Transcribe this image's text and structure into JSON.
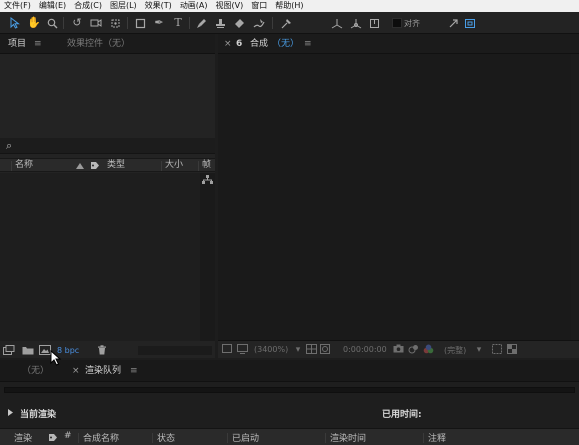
{
  "menu": [
    "文件(F)",
    "编辑(E)",
    "合成(C)",
    "图层(L)",
    "效果(T)",
    "动画(A)",
    "视图(V)",
    "窗口",
    "帮助(H)"
  ],
  "toolbar": {
    "snap_label": "对齐"
  },
  "project_panel": {
    "tab_project": "项目",
    "tab_menu": "≡",
    "tab_effects": "效果控件（无）",
    "search_icon": "⌕",
    "columns": {
      "name": "名称",
      "type": "类型",
      "size": "大小",
      "frame": "帧"
    },
    "bpc": "8 bpc"
  },
  "comp_panel": {
    "close": "×",
    "lock": "6",
    "title": "合成",
    "title_value": "（无）",
    "menu": "≡",
    "zoom": "(3400%)",
    "timecode": "0:00:00:00",
    "quality": "(完整)"
  },
  "render_queue": {
    "tab_none": "（无）",
    "tab_close": "×",
    "tab_render": "渲染队列",
    "tab_menu": "≡",
    "current_render": "当前渲染",
    "elapsed": "已用时间:",
    "columns": {
      "render": "渲染",
      "num": "#",
      "comp_name": "合成名称",
      "status": "状态",
      "started": "已启动",
      "render_time": "渲染时间",
      "comment": "注释"
    }
  },
  "colors": {
    "accent_blue": "#4a9ee6",
    "panel_bg": "#1f1f1f",
    "menubar_bg": "#f0f0f0"
  }
}
